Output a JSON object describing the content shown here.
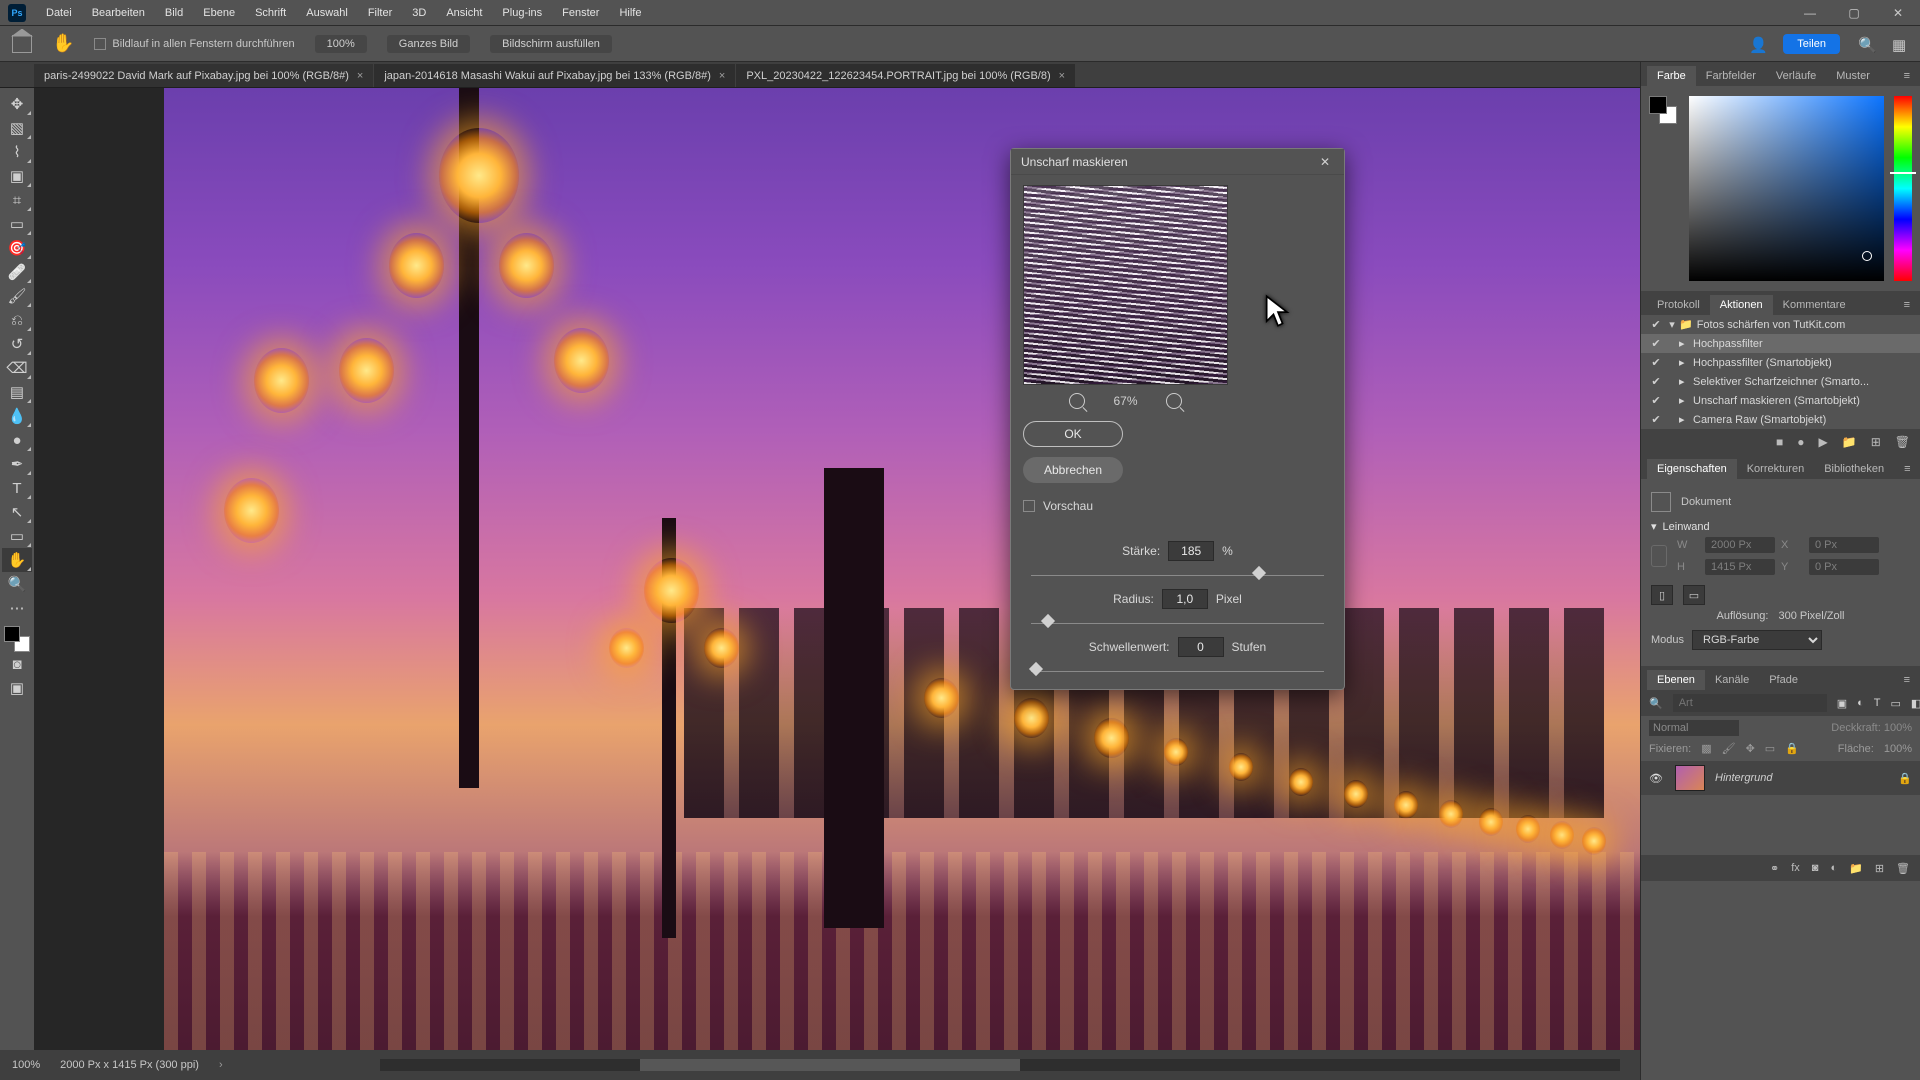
{
  "menu": {
    "items": [
      "Datei",
      "Bearbeiten",
      "Bild",
      "Ebene",
      "Schrift",
      "Auswahl",
      "Filter",
      "3D",
      "Ansicht",
      "Plug-ins",
      "Fenster",
      "Hilfe"
    ]
  },
  "optionsbar": {
    "scroll_all_windows": "Bildlauf in allen Fenstern durchführen",
    "zoom_100": "100%",
    "fit_screen": "Ganzes Bild",
    "fill_screen": "Bildschirm ausfüllen",
    "share": "Teilen"
  },
  "tabs": [
    {
      "label": "paris-2499022 David Mark auf Pixabay.jpg bei 100% (RGB/8#)",
      "active": true
    },
    {
      "label": "japan-2014618 Masashi Wakui auf Pixabay.jpg bei 133% (RGB/8#)",
      "active": false
    },
    {
      "label": "PXL_20230422_122623454.PORTRAIT.jpg bei 100% (RGB/8)",
      "active": false
    }
  ],
  "statusbar": {
    "zoom": "100%",
    "docinfo": "2000 Px x 1415 Px (300 ppi)"
  },
  "panels": {
    "color_tabs": [
      "Farbe",
      "Farbfelder",
      "Verläufe",
      "Muster"
    ],
    "history_tabs": [
      "Protokoll",
      "Aktionen",
      "Kommentare"
    ],
    "prop_tabs": [
      "Eigenschaften",
      "Korrekturen",
      "Bibliotheken"
    ],
    "layer_tabs": [
      "Ebenen",
      "Kanäle",
      "Pfade"
    ]
  },
  "actions": {
    "set": "Fotos schärfen von TutKit.com",
    "items": [
      "Hochpassfilter",
      "Hochpassfilter (Smartobjekt)",
      "Selektiver Scharfzeichner (Smarto...",
      "Unscharf maskieren (Smartobjekt)",
      "Camera Raw (Smartobjekt)"
    ]
  },
  "properties": {
    "doc_label": "Dokument",
    "section": "Leinwand",
    "w_label": "W",
    "w_val": "2000 Px",
    "x_label": "X",
    "x_val": "0 Px",
    "h_label": "H",
    "h_val": "1415 Px",
    "y_label": "Y",
    "y_val": "0 Px",
    "res_label": "Auflösung:",
    "res_val": "300 Pixel/Zoll",
    "mode_label": "Modus",
    "mode_val": "RGB-Farbe"
  },
  "layers": {
    "filter_placeholder": "Art",
    "blend": "Normal",
    "opacity_label": "Deckkraft:",
    "opacity": "100%",
    "lock_label": "Fixieren:",
    "fill_label": "Fläche:",
    "fill": "100%",
    "layer_name": "Hintergrund"
  },
  "dialog": {
    "title": "Unscharf maskieren",
    "ok": "OK",
    "cancel": "Abbrechen",
    "preview": "Vorschau",
    "zoom": "67%",
    "amount_label": "Stärke:",
    "amount": "185",
    "amount_unit": "%",
    "radius_label": "Radius:",
    "radius": "1,0",
    "radius_unit": "Pixel",
    "threshold_label": "Schwellenwert:",
    "threshold": "0",
    "threshold_unit": "Stufen"
  }
}
